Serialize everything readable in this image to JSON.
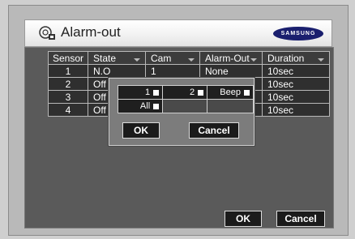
{
  "window": {
    "title": "Alarm-out",
    "brand": "SAMSUNG"
  },
  "table": {
    "headers": [
      "Sensor",
      "State",
      "Cam",
      "Alarm-Out",
      "Duration"
    ],
    "rows": [
      {
        "sensor": "1",
        "state": "N.O",
        "cam": "1",
        "alarm_out": "None",
        "duration": "10sec"
      },
      {
        "sensor": "2",
        "state": "Off",
        "cam": "",
        "alarm_out": "",
        "duration": "10sec"
      },
      {
        "sensor": "3",
        "state": "Off",
        "cam": "",
        "alarm_out": "",
        "duration": "10sec"
      },
      {
        "sensor": "4",
        "state": "Off",
        "cam": "",
        "alarm_out": "",
        "duration": "10sec"
      }
    ]
  },
  "popup": {
    "options": [
      "1",
      "2",
      "Beep",
      "All"
    ],
    "ok_label": "OK",
    "cancel_label": "Cancel"
  },
  "footer": {
    "ok_label": "OK",
    "cancel_label": "Cancel"
  },
  "colors": {
    "brand_bg": "#1a1f6e",
    "panel_bg": "#5a5a5a",
    "cell_bg": "#2f2f2f"
  },
  "icons": {
    "title_icon": "alarm-speaker-icon"
  }
}
